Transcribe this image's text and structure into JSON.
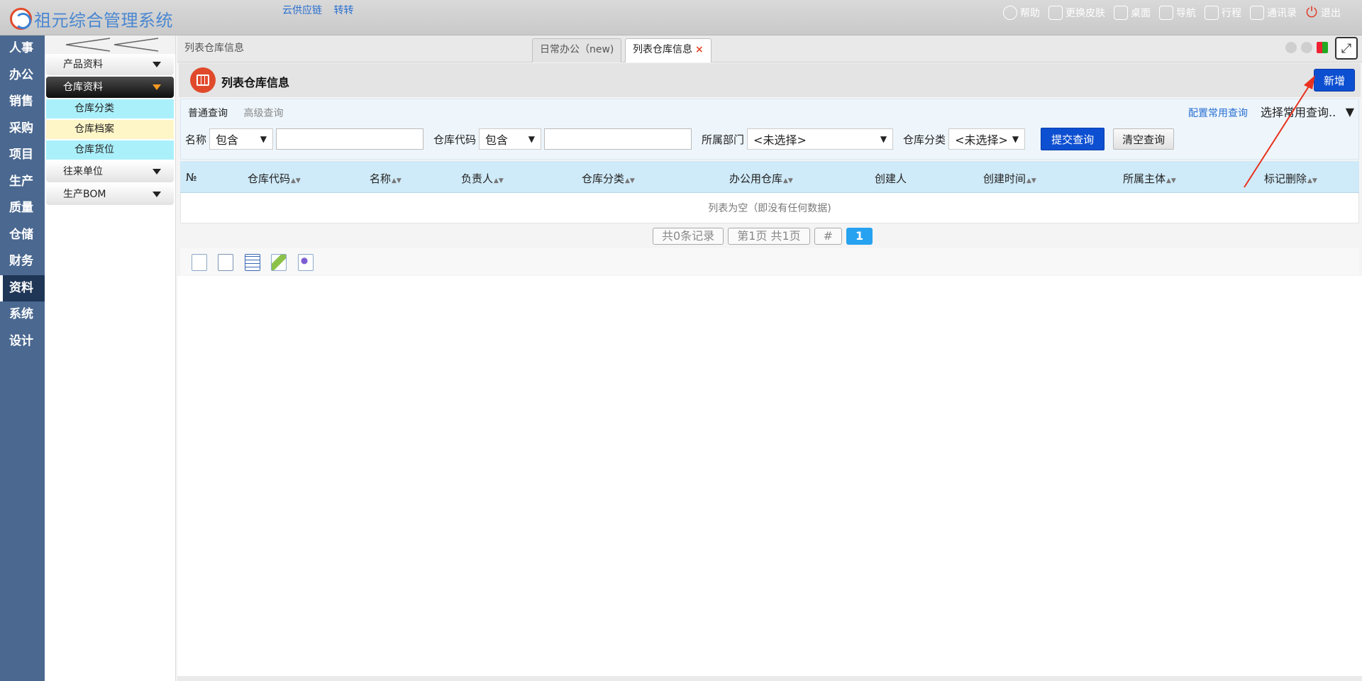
{
  "app": {
    "title": "祖元综合管理系统",
    "top_links": [
      "云供应链",
      "转转"
    ],
    "top_actions": [
      {
        "label": "帮助",
        "icon": "help-icon"
      },
      {
        "label": "更换皮肤",
        "icon": "shirt-icon"
      },
      {
        "label": "桌面",
        "icon": "home-icon"
      },
      {
        "label": "导航",
        "icon": "grid-icon"
      },
      {
        "label": "行程",
        "icon": "calendar-icon"
      },
      {
        "label": "通讯录",
        "icon": "contacts-icon"
      },
      {
        "label": "退出",
        "icon": "power-icon"
      }
    ]
  },
  "leftnav": {
    "items": [
      "人事",
      "办公",
      "销售",
      "采购",
      "项目",
      "生产",
      "质量",
      "仓储",
      "财务",
      "资料",
      "系统",
      "设计"
    ],
    "active": "资料"
  },
  "submenu": {
    "groups": [
      {
        "label": "产品资料"
      },
      {
        "label": "仓库资料"
      },
      {
        "label": "往来单位"
      },
      {
        "label": "生产BOM"
      }
    ],
    "subitems": [
      "仓库分类",
      "仓库档案",
      "仓库货位"
    ]
  },
  "workspace": {
    "breadcrumb": "列表仓库信息",
    "tabs": [
      {
        "label": "日常办公（new)"
      },
      {
        "label": "列表仓库信息",
        "close": "×"
      }
    ]
  },
  "page": {
    "title": "列表仓库信息",
    "add_label": "新增"
  },
  "query": {
    "tab_normal": "普通查询",
    "tab_advanced": "高级查询",
    "config_link": "配置常用查询",
    "preset_select": "选择常用查询..",
    "fields": [
      {
        "label": "名称",
        "op": "包含",
        "value": ""
      },
      {
        "label": "仓库代码",
        "op": "包含",
        "value": ""
      },
      {
        "label": "所属部门",
        "value": "<未选择>"
      },
      {
        "label": "仓库分类",
        "value": "<未选择>"
      }
    ],
    "submit_label": "提交查询",
    "clear_label": "清空查询"
  },
  "table": {
    "columns": [
      "№",
      "仓库代码",
      "名称",
      "负责人",
      "仓库分类",
      "办公用仓库",
      "创建人",
      "创建时间",
      "所属主体",
      "标记删除"
    ],
    "sortable": [
      false,
      true,
      true,
      true,
      true,
      true,
      false,
      true,
      true,
      true
    ],
    "empty_text": "列表为空（即没有任何数据)"
  },
  "pager": {
    "records": "共0条记录",
    "pages": "第1页 共1页",
    "hash": "#",
    "current": "1"
  },
  "colors": {
    "primary_button": "#0d4fd1",
    "left_nav": "#4a6890",
    "table_header": "#cfeaf8",
    "annotation_arrow": "#e8321e"
  }
}
